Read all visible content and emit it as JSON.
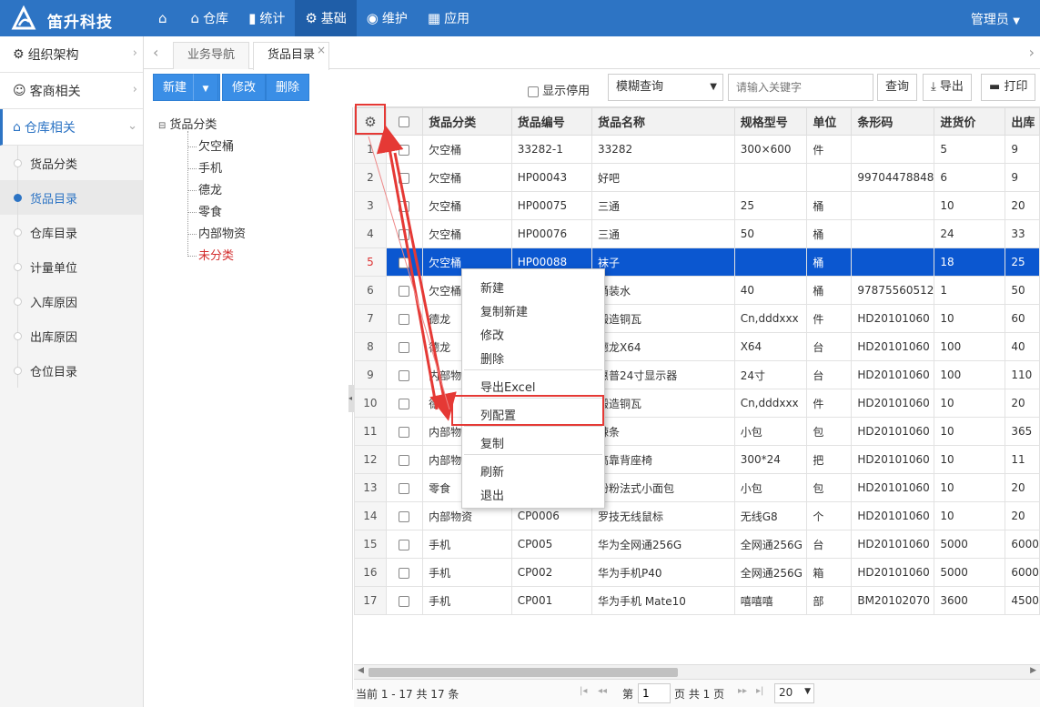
{
  "header": {
    "brand": "笛升科技",
    "user": "管理员",
    "nav": [
      {
        "label": "",
        "icon": "home-icon"
      },
      {
        "label": "仓库",
        "icon": "warehouse-icon"
      },
      {
        "label": "统计",
        "icon": "bar-chart-icon"
      },
      {
        "label": "基础",
        "icon": "gear-icon",
        "active": true
      },
      {
        "label": "维护",
        "icon": "maintenance-icon"
      },
      {
        "label": "应用",
        "icon": "apps-icon"
      }
    ]
  },
  "sidebar": {
    "groups": [
      {
        "label": "组织架构",
        "icon": "gear-icon"
      },
      {
        "label": "客商相关",
        "icon": "user-icon"
      },
      {
        "label": "仓库相关",
        "icon": "home-icon"
      }
    ],
    "items": [
      "货品分类",
      "货品目录",
      "仓库目录",
      "计量单位",
      "入库原因",
      "出库原因",
      "仓位目录"
    ],
    "active_index": 1
  },
  "tabs": [
    "业务导航",
    "货品目录"
  ],
  "toolbar": {
    "new": "新建",
    "edit": "修改",
    "delete": "删除",
    "show_disabled": "显示停用",
    "search_mode": "模糊查询",
    "search_placeholder": "请输入关键字",
    "query": "查询",
    "export": "导出",
    "print": "打印"
  },
  "tree": {
    "root": "货品分类",
    "children": [
      "欠空桶",
      "手机",
      "德龙",
      "零食",
      "内部物资",
      "未分类"
    ]
  },
  "table": {
    "columns": [
      "货品分类",
      "货品编号",
      "货品名称",
      "规格型号",
      "单位",
      "条形码",
      "进货价",
      "出库"
    ],
    "rows": [
      [
        "1",
        "欠空桶",
        "33282-1",
        "33282",
        "300×600",
        "件",
        "",
        "5",
        "9"
      ],
      [
        "2",
        "欠空桶",
        "HP00043",
        "好吧",
        "",
        "",
        "99704478848",
        "6",
        "9"
      ],
      [
        "3",
        "欠空桶",
        "HP00075",
        "三通",
        "25",
        "桶",
        "",
        "10",
        "20"
      ],
      [
        "4",
        "欠空桶",
        "HP00076",
        "三通",
        "50",
        "桶",
        "",
        "24",
        "33"
      ],
      [
        "5",
        "欠空桶",
        "HP00088",
        "袜子",
        "",
        "桶",
        "",
        "18",
        "25"
      ],
      [
        "6",
        "欠空桶",
        "",
        "桶装水",
        "40",
        "桶",
        "97875560512",
        "1",
        "50"
      ],
      [
        "7",
        "德龙",
        "",
        "锻造铜瓦",
        "Cn,dddxxx",
        "件",
        "HD20101060",
        "10",
        "60"
      ],
      [
        "8",
        "德龙",
        "",
        "德龙X64",
        "X64",
        "台",
        "HD20101060",
        "100",
        "40"
      ],
      [
        "9",
        "内部物资",
        "",
        "惠普24寸显示器",
        "24寸",
        "台",
        "HD20101060",
        "100",
        "110"
      ],
      [
        "10",
        "德龙",
        "",
        "锻造铜瓦",
        "Cn,dddxxx",
        "件",
        "HD20101060",
        "10",
        "20"
      ],
      [
        "11",
        "内部物资",
        "",
        "辣条",
        "小包",
        "包",
        "HD20101060",
        "10",
        "365"
      ],
      [
        "12",
        "内部物资",
        "",
        "高靠背座椅",
        "300*24",
        "把",
        "HD20101060",
        "10",
        "11"
      ],
      [
        "13",
        "零食",
        "",
        "粉粉法式小面包",
        "小包",
        "包",
        "HD20101060",
        "10",
        "20"
      ],
      [
        "14",
        "内部物资",
        "CP0006",
        "罗技无线鼠标",
        "无线G8",
        "个",
        "HD20101060",
        "10",
        "20"
      ],
      [
        "15",
        "手机",
        "CP005",
        "华为全网通256G",
        "全网通256G",
        "台",
        "HD20101060",
        "5000",
        "6000"
      ],
      [
        "16",
        "手机",
        "CP002",
        "华为手机P40",
        "全网通256G",
        "箱",
        "HD20101060",
        "5000",
        "6000"
      ],
      [
        "17",
        "手机",
        "CP001",
        "华为手机 Mate10",
        "嘻嘻嘻",
        "部",
        "BM20102070",
        "3600",
        "4500"
      ]
    ],
    "selected_row": 4
  },
  "context_menu": [
    "新建",
    "复制新建",
    "修改",
    "删除",
    "导出Excel",
    "列配置",
    "复制",
    "刷新",
    "退出"
  ],
  "pager": {
    "summary": "当前 1 - 17 共 17 条",
    "page_label": "第",
    "page": "1",
    "total_label": "页 共 1 页",
    "page_size": "20"
  },
  "colors": {
    "header_bg": "#2d74c4",
    "selected_row": "#0b57d0",
    "highlight": "#e53935"
  }
}
